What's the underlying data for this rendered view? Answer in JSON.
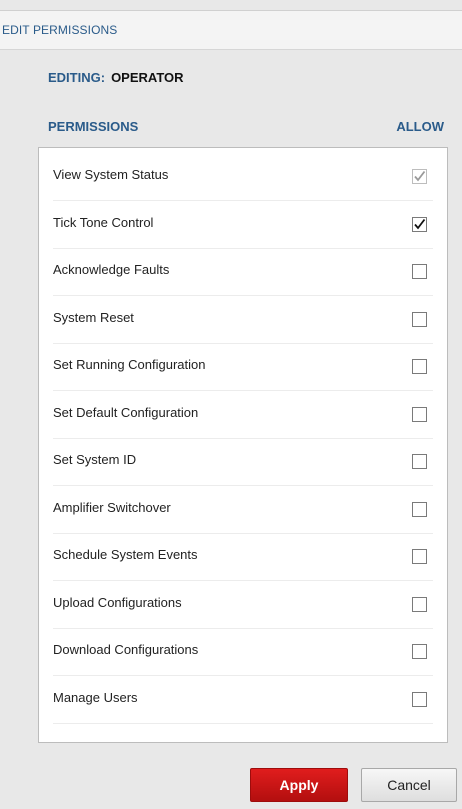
{
  "dialog": {
    "title": "EDIT PERMISSIONS",
    "editing_label": "EDITING:",
    "editing_value": "OPERATOR",
    "permissions_header": "PERMISSIONS",
    "allow_header": "ALLOW"
  },
  "permissions": [
    {
      "label": "View System Status",
      "checked": true,
      "disabled": true
    },
    {
      "label": "Tick Tone Control",
      "checked": true,
      "disabled": false
    },
    {
      "label": "Acknowledge Faults",
      "checked": false,
      "disabled": false
    },
    {
      "label": "System Reset",
      "checked": false,
      "disabled": false
    },
    {
      "label": "Set Running Configuration",
      "checked": false,
      "disabled": false
    },
    {
      "label": "Set Default Configuration",
      "checked": false,
      "disabled": false
    },
    {
      "label": "Set System ID",
      "checked": false,
      "disabled": false
    },
    {
      "label": "Amplifier Switchover",
      "checked": false,
      "disabled": false
    },
    {
      "label": "Schedule System Events",
      "checked": false,
      "disabled": false
    },
    {
      "label": "Upload Configurations",
      "checked": false,
      "disabled": false
    },
    {
      "label": "Download Configurations",
      "checked": false,
      "disabled": false
    },
    {
      "label": "Manage Users",
      "checked": false,
      "disabled": false
    }
  ],
  "buttons": {
    "apply_label": "Apply",
    "cancel_label": "Cancel"
  },
  "colors": {
    "accent_blue": "#2a5b8a",
    "apply_red": "#d01515",
    "check_enabled": "#111111",
    "check_disabled": "#9a9a9a"
  }
}
